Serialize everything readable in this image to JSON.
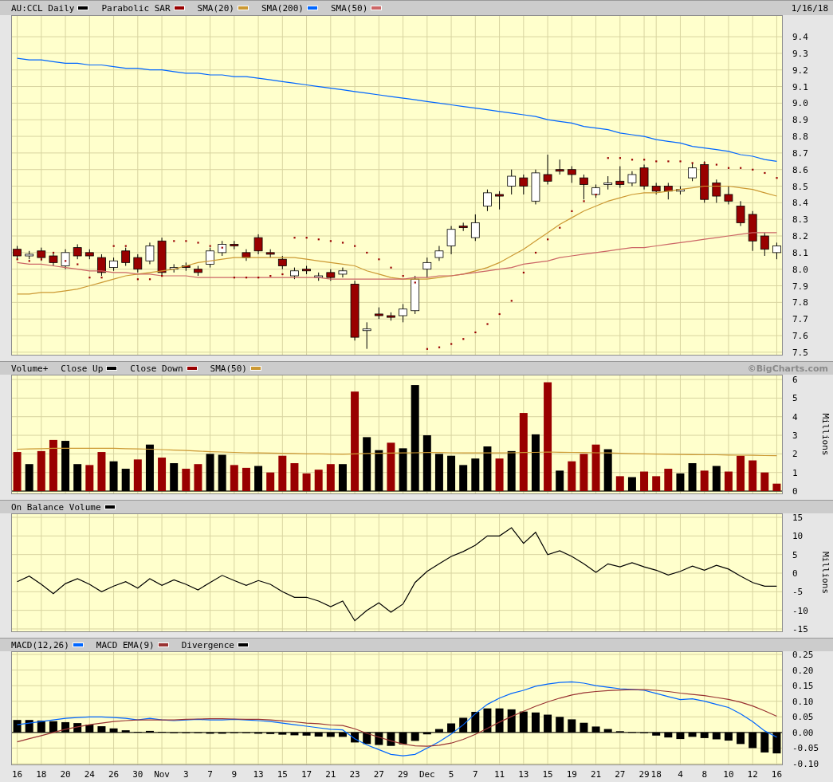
{
  "panels": [
    {
      "aside": {
        "kind": "date",
        "text": "1/16/18"
      },
      "chart_data": {
        "type": "candlestick",
        "title": "AU:CCL Daily",
        "grid": true,
        "ylim": [
          7.48,
          9.53
        ],
        "yticks": [
          {
            "value": 7.5,
            "label": "7.5"
          },
          {
            "value": 7.6,
            "label": "7.6"
          },
          {
            "value": 7.7,
            "label": "7.7"
          },
          {
            "value": 7.8,
            "label": "7.8"
          },
          {
            "value": 7.9,
            "label": "7.9"
          },
          {
            "value": 8.0,
            "label": "8.0"
          },
          {
            "value": 8.1,
            "label": "8.1"
          },
          {
            "value": 8.2,
            "label": "8.2"
          },
          {
            "value": 8.3,
            "label": "8.3"
          },
          {
            "value": 8.4,
            "label": "8.4"
          },
          {
            "value": 8.5,
            "label": "8.5"
          },
          {
            "value": 8.6,
            "label": "8.6"
          },
          {
            "value": 8.7,
            "label": "8.7"
          },
          {
            "value": 8.8,
            "label": "8.8"
          },
          {
            "value": 8.9,
            "label": "8.9"
          },
          {
            "value": 9.0,
            "label": "9.0"
          },
          {
            "value": 9.1,
            "label": "9.1"
          },
          {
            "value": 9.2,
            "label": "9.2"
          },
          {
            "value": 9.3,
            "label": "9.3"
          },
          {
            "value": 9.4,
            "label": "9.4"
          }
        ],
        "ohlc": [
          [
            8.12,
            8.14,
            8.06,
            8.08
          ],
          [
            8.08,
            8.11,
            8.06,
            8.09
          ],
          [
            8.11,
            8.13,
            8.05,
            8.07
          ],
          [
            8.08,
            8.1,
            8.02,
            8.04
          ],
          [
            8.02,
            8.12,
            8.0,
            8.1
          ],
          [
            8.13,
            8.15,
            8.06,
            8.08
          ],
          [
            8.1,
            8.12,
            8.06,
            8.08
          ],
          [
            8.07,
            8.09,
            7.96,
            7.98
          ],
          [
            8.01,
            8.07,
            7.99,
            8.05
          ],
          [
            8.11,
            8.13,
            8.02,
            8.04
          ],
          [
            8.07,
            8.09,
            7.98,
            8.0
          ],
          [
            8.05,
            8.16,
            8.03,
            8.14
          ],
          [
            8.17,
            8.19,
            7.96,
            7.98
          ],
          [
            8.0,
            8.03,
            7.98,
            8.01
          ],
          [
            8.02,
            8.04,
            7.99,
            8.01
          ],
          [
            8.0,
            8.02,
            7.96,
            7.98
          ],
          [
            8.03,
            8.13,
            8.01,
            8.11
          ],
          [
            8.1,
            8.17,
            8.08,
            8.15
          ],
          [
            8.15,
            8.17,
            8.12,
            8.14
          ],
          [
            8.1,
            8.12,
            8.05,
            8.07
          ],
          [
            8.19,
            8.21,
            8.09,
            8.11
          ],
          [
            8.1,
            8.12,
            8.07,
            8.09
          ],
          [
            8.06,
            8.08,
            8.0,
            8.02
          ],
          [
            7.96,
            8.01,
            7.94,
            7.99
          ],
          [
            8.0,
            8.02,
            7.97,
            7.99
          ],
          [
            7.95,
            7.98,
            7.93,
            7.96
          ],
          [
            7.98,
            8.0,
            7.93,
            7.95
          ],
          [
            7.97,
            8.01,
            7.95,
            7.99
          ],
          [
            7.91,
            7.93,
            7.57,
            7.59
          ],
          [
            7.63,
            7.68,
            7.52,
            7.64
          ],
          [
            7.73,
            7.77,
            7.7,
            7.72
          ],
          [
            7.72,
            7.74,
            7.69,
            7.71
          ],
          [
            7.72,
            7.79,
            7.68,
            7.76
          ],
          [
            7.75,
            7.96,
            7.73,
            7.94
          ],
          [
            8.0,
            8.07,
            7.95,
            8.04
          ],
          [
            8.07,
            8.14,
            8.05,
            8.11
          ],
          [
            8.14,
            8.26,
            8.09,
            8.24
          ],
          [
            8.26,
            8.28,
            8.23,
            8.25
          ],
          [
            8.19,
            8.33,
            8.17,
            8.28
          ],
          [
            8.38,
            8.48,
            8.35,
            8.46
          ],
          [
            8.45,
            8.47,
            8.36,
            8.44
          ],
          [
            8.5,
            8.6,
            8.45,
            8.56
          ],
          [
            8.55,
            8.57,
            8.45,
            8.5
          ],
          [
            8.41,
            8.6,
            8.39,
            8.58
          ],
          [
            8.57,
            8.69,
            8.51,
            8.53
          ],
          [
            8.6,
            8.66,
            8.57,
            8.59
          ],
          [
            8.6,
            8.62,
            8.52,
            8.57
          ],
          [
            8.55,
            8.57,
            8.42,
            8.51
          ],
          [
            8.45,
            8.51,
            8.43,
            8.49
          ],
          [
            8.51,
            8.56,
            8.48,
            8.52
          ],
          [
            8.53,
            8.62,
            8.49,
            8.51
          ],
          [
            8.52,
            8.59,
            8.5,
            8.57
          ],
          [
            8.61,
            8.63,
            8.48,
            8.5
          ],
          [
            8.5,
            8.52,
            8.45,
            8.47
          ],
          [
            8.5,
            8.52,
            8.42,
            8.47
          ],
          [
            8.47,
            8.5,
            8.45,
            8.48
          ],
          [
            8.55,
            8.64,
            8.53,
            8.61
          ],
          [
            8.63,
            8.65,
            8.4,
            8.42
          ],
          [
            8.52,
            8.54,
            8.4,
            8.44
          ],
          [
            8.45,
            8.5,
            8.39,
            8.41
          ],
          [
            8.38,
            8.41,
            8.26,
            8.28
          ],
          [
            8.33,
            8.35,
            8.11,
            8.17
          ],
          [
            8.2,
            8.22,
            8.08,
            8.12
          ],
          [
            8.1,
            8.16,
            8.06,
            8.14
          ]
        ],
        "series": [
          {
            "name": "Parabolic SAR",
            "type": "scatter",
            "marker": "square",
            "color": "#990000",
            "values": [
              8.06,
              8.05,
              8.06,
              8.1,
              8.05,
              8.03,
              7.95,
              7.95,
              8.14,
              8.14,
              7.94,
              7.94,
              7.96,
              8.17,
              8.17,
              8.16,
              8.14,
              8.13,
              7.95,
              7.95,
              7.95,
              7.96,
              7.97,
              8.19,
              8.19,
              8.18,
              8.17,
              8.16,
              8.14,
              8.1,
              8.06,
              8.01,
              7.96,
              7.92,
              7.52,
              7.53,
              7.55,
              7.58,
              7.62,
              7.67,
              7.73,
              7.81,
              7.98,
              8.1,
              8.18,
              8.25,
              8.35,
              8.41,
              8.45,
              8.67,
              8.67,
              8.66,
              8.66,
              8.65,
              8.65,
              8.65,
              8.64,
              8.64,
              8.63,
              8.61,
              8.61,
              8.6,
              8.58,
              8.55
            ]
          },
          {
            "name": "SMA(20)",
            "type": "line",
            "color": "#cc9933",
            "values": [
              7.85,
              7.85,
              7.86,
              7.86,
              7.87,
              7.88,
              7.9,
              7.92,
              7.94,
              7.96,
              7.97,
              7.98,
              7.99,
              8.0,
              8.02,
              8.04,
              8.05,
              8.06,
              8.07,
              8.07,
              8.07,
              8.07,
              8.07,
              8.07,
              8.06,
              8.05,
              8.04,
              8.03,
              8.02,
              7.99,
              7.97,
              7.95,
              7.94,
              7.94,
              7.94,
              7.95,
              7.96,
              7.97,
              7.99,
              8.01,
              8.04,
              8.08,
              8.12,
              8.17,
              8.22,
              8.27,
              8.31,
              8.35,
              8.38,
              8.41,
              8.43,
              8.45,
              8.46,
              8.46,
              8.47,
              8.48,
              8.49,
              8.5,
              8.5,
              8.5,
              8.49,
              8.48,
              8.46,
              8.44
            ]
          },
          {
            "name": "SMA(200)",
            "type": "line",
            "color": "#0066ff",
            "values": [
              9.27,
              9.26,
              9.26,
              9.25,
              9.24,
              9.24,
              9.23,
              9.23,
              9.22,
              9.21,
              9.21,
              9.2,
              9.2,
              9.19,
              9.18,
              9.18,
              9.17,
              9.17,
              9.16,
              9.16,
              9.15,
              9.14,
              9.13,
              9.12,
              9.11,
              9.1,
              9.09,
              9.08,
              9.07,
              9.06,
              9.05,
              9.04,
              9.03,
              9.02,
              9.01,
              9.0,
              8.99,
              8.98,
              8.97,
              8.96,
              8.95,
              8.94,
              8.93,
              8.92,
              8.9,
              8.89,
              8.88,
              8.86,
              8.85,
              8.84,
              8.82,
              8.81,
              8.8,
              8.78,
              8.77,
              8.76,
              8.74,
              8.73,
              8.72,
              8.71,
              8.69,
              8.68,
              8.66,
              8.65
            ]
          },
          {
            "name": "SMA(50)",
            "type": "line",
            "color": "#cc6666",
            "values": [
              8.04,
              8.03,
              8.03,
              8.02,
              8.01,
              8.0,
              7.99,
              7.99,
              7.98,
              7.98,
              7.97,
              7.97,
              7.96,
              7.96,
              7.96,
              7.95,
              7.95,
              7.95,
              7.95,
              7.95,
              7.95,
              7.95,
              7.95,
              7.95,
              7.95,
              7.95,
              7.94,
              7.94,
              7.94,
              7.94,
              7.94,
              7.94,
              7.94,
              7.95,
              7.95,
              7.96,
              7.96,
              7.97,
              7.98,
              7.99,
              8.0,
              8.01,
              8.03,
              8.04,
              8.05,
              8.07,
              8.08,
              8.09,
              8.1,
              8.11,
              8.12,
              8.13,
              8.13,
              8.14,
              8.15,
              8.16,
              8.17,
              8.18,
              8.19,
              8.2,
              8.21,
              8.22,
              8.22,
              8.22
            ]
          }
        ]
      }
    },
    {
      "aside": {
        "kind": "credit",
        "text": "©BigCharts.com"
      },
      "chart_data": {
        "type": "bar",
        "title": "Volume+",
        "ylabel": "Millions",
        "grid": true,
        "ylim": [
          -0.17,
          6.26
        ],
        "yticks": [
          {
            "value": 0,
            "label": "0"
          },
          {
            "value": 1,
            "label": "1"
          },
          {
            "value": 2,
            "label": "2"
          },
          {
            "value": 3,
            "label": "3"
          },
          {
            "value": 4,
            "label": "4"
          },
          {
            "value": 5,
            "label": "5"
          },
          {
            "value": 6,
            "label": "6"
          }
        ],
        "series": [
          {
            "name": "Close Up",
            "type": "bar",
            "color": "#000000",
            "values": [
              null,
              1.45,
              null,
              null,
              2.7,
              1.45,
              null,
              null,
              1.6,
              1.2,
              null,
              2.5,
              null,
              1.5,
              null,
              null,
              2.0,
              1.95,
              null,
              null,
              1.35,
              null,
              null,
              null,
              null,
              null,
              null,
              1.45,
              null,
              2.9,
              2.2,
              null,
              2.3,
              5.7,
              3.0,
              2.0,
              1.9,
              1.4,
              1.75,
              2.4,
              null,
              2.15,
              null,
              3.05,
              null,
              1.1,
              null,
              null,
              null,
              2.25,
              null,
              0.75,
              null,
              null,
              null,
              0.95,
              1.5,
              null,
              1.35,
              null,
              null,
              null,
              null,
              null
            ]
          },
          {
            "name": "Close Down",
            "type": "bar",
            "color": "#990000",
            "values": [
              2.1,
              null,
              2.15,
              2.75,
              null,
              null,
              1.4,
              2.1,
              null,
              null,
              1.7,
              null,
              1.8,
              null,
              1.2,
              1.45,
              null,
              null,
              1.4,
              1.25,
              null,
              1.0,
              1.9,
              1.5,
              0.95,
              1.15,
              1.45,
              null,
              5.35,
              null,
              null,
              2.6,
              null,
              null,
              null,
              null,
              null,
              null,
              null,
              null,
              1.75,
              null,
              4.2,
              null,
              5.85,
              null,
              1.6,
              2.0,
              2.5,
              null,
              0.8,
              null,
              1.05,
              0.8,
              1.2,
              null,
              null,
              1.1,
              null,
              1.05,
              1.9,
              1.65,
              1.0,
              0.4
            ]
          },
          {
            "name": "SMA(50)",
            "type": "line",
            "color": "#cc9933",
            "values": [
              2.25,
              2.27,
              2.28,
              2.3,
              2.3,
              2.3,
              2.3,
              2.3,
              2.3,
              2.28,
              2.27,
              2.25,
              2.23,
              2.2,
              2.18,
              2.15,
              2.12,
              2.1,
              2.08,
              2.06,
              2.05,
              2.04,
              2.03,
              2.02,
              2.0,
              2.0,
              1.99,
              1.98,
              2.0,
              2.02,
              2.03,
              2.04,
              2.05,
              2.06,
              2.07,
              2.07,
              2.06,
              2.05,
              2.05,
              2.05,
              2.05,
              2.06,
              2.07,
              2.08,
              2.1,
              2.09,
              2.08,
              2.07,
              2.06,
              2.05,
              2.03,
              2.01,
              2.0,
              1.99,
              1.98,
              1.97,
              1.96,
              1.95,
              1.95,
              1.94,
              1.93,
              1.92,
              1.91,
              1.9
            ]
          }
        ]
      }
    },
    {
      "chart_data": {
        "type": "line",
        "ylabel": "Millions",
        "grid": true,
        "ylim": [
          -15.86,
          16.07
        ],
        "yticks": [
          {
            "value": -15,
            "label": "-15"
          },
          {
            "value": -10,
            "label": "-10"
          },
          {
            "value": -5,
            "label": "-5"
          },
          {
            "value": 0,
            "label": "0"
          },
          {
            "value": 5,
            "label": "5"
          },
          {
            "value": 10,
            "label": "10"
          },
          {
            "value": 15,
            "label": "15"
          }
        ],
        "series": [
          {
            "name": "On Balance Volume",
            "type": "line",
            "color": "#000000",
            "values": [
              -2.3,
              -0.8,
              -3,
              -5.5,
              -2.8,
              -1.5,
              -3,
              -5,
              -3.5,
              -2.3,
              -4,
              -1.5,
              -3.3,
              -1.8,
              -3,
              -4.5,
              -2.5,
              -0.6,
              -2,
              -3.3,
              -2,
              -3,
              -5,
              -6.5,
              -6.5,
              -7.5,
              -9,
              -7.5,
              -12.8,
              -10,
              -8,
              -10.5,
              -8.3,
              -2.5,
              0.5,
              2.5,
              4.5,
              5.8,
              7.5,
              10,
              10,
              12.2,
              8,
              11,
              5,
              6,
              4.5,
              2.5,
              0.2,
              2.5,
              1.7,
              2.8,
              1.7,
              0.8,
              -0.5,
              0.5,
              1.9,
              0.8,
              2.1,
              1.1,
              -0.8,
              -2.5,
              -3.5,
              -3.5
            ]
          }
        ]
      }
    },
    {
      "chart_data": {
        "type": "line",
        "grid": true,
        "ylim": [
          -0.105,
          0.26
        ],
        "categories": [
          "16",
          null,
          "18",
          null,
          "20",
          null,
          "24",
          null,
          "26",
          null,
          "30",
          null,
          "Nov",
          null,
          "3",
          null,
          "7",
          null,
          "9",
          null,
          "13",
          null,
          "15",
          null,
          "17",
          null,
          "21",
          null,
          "23",
          null,
          "27",
          null,
          "29",
          null,
          "Dec",
          null,
          "5",
          null,
          "7",
          null,
          "11",
          null,
          "13",
          null,
          "15",
          null,
          "19",
          null,
          "21",
          null,
          "27",
          null,
          "29",
          "18",
          null,
          "4",
          null,
          "8",
          null,
          "10",
          null,
          "12",
          null,
          "16"
        ],
        "yticks": [
          {
            "value": -0.1,
            "label": "-0.10"
          },
          {
            "value": -0.05,
            "label": "-0.05"
          },
          {
            "value": 0,
            "label": "0.00"
          },
          {
            "value": 0.05,
            "label": "0.05"
          },
          {
            "value": 0.1,
            "label": "0.10"
          },
          {
            "value": 0.15,
            "label": "0.15"
          },
          {
            "value": 0.2,
            "label": "0.20"
          },
          {
            "value": 0.25,
            "label": "0.25"
          }
        ],
        "series": [
          {
            "name": "MACD(12,26)",
            "type": "line",
            "color": "#0066ff",
            "values": [
              0.025,
              0.03,
              0.035,
              0.04,
              0.045,
              0.048,
              0.05,
              0.05,
              0.048,
              0.045,
              0.04,
              0.045,
              0.04,
              0.038,
              0.04,
              0.042,
              0.04,
              0.04,
              0.042,
              0.04,
              0.038,
              0.035,
              0.03,
              0.025,
              0.02,
              0.015,
              0.01,
              0.008,
              -0.02,
              -0.04,
              -0.055,
              -0.07,
              -0.075,
              -0.07,
              -0.05,
              -0.03,
              -0.005,
              0.025,
              0.06,
              0.09,
              0.11,
              0.125,
              0.135,
              0.148,
              0.155,
              0.16,
              0.162,
              0.158,
              0.15,
              0.145,
              0.14,
              0.138,
              0.135,
              0.125,
              0.115,
              0.105,
              0.108,
              0.1,
              0.09,
              0.08,
              0.06,
              0.035,
              0.005,
              -0.015
            ]
          },
          {
            "name": "MACD EMA(9)",
            "type": "line",
            "color": "#993333",
            "values": [
              -0.03,
              -0.02,
              -0.01,
              0.0,
              0.01,
              0.018,
              0.025,
              0.03,
              0.035,
              0.038,
              0.04,
              0.04,
              0.04,
              0.04,
              0.042,
              0.043,
              0.044,
              0.044,
              0.043,
              0.042,
              0.042,
              0.04,
              0.037,
              0.034,
              0.03,
              0.028,
              0.024,
              0.022,
              0.012,
              -0.003,
              -0.015,
              -0.027,
              -0.037,
              -0.043,
              -0.044,
              -0.041,
              -0.034,
              -0.022,
              -0.006,
              0.013,
              0.033,
              0.051,
              0.068,
              0.084,
              0.098,
              0.11,
              0.12,
              0.127,
              0.131,
              0.134,
              0.136,
              0.137,
              0.137,
              0.135,
              0.131,
              0.126,
              0.122,
              0.118,
              0.112,
              0.106,
              0.097,
              0.085,
              0.069,
              0.052
            ]
          },
          {
            "name": "Divergence",
            "type": "bar",
            "color": "#000000",
            "values": [
              0.04,
              0.04,
              0.038,
              0.036,
              0.033,
              0.03,
              0.025,
              0.02,
              0.013,
              0.007,
              0.002,
              0.005,
              0.002,
              -0.002,
              -0.002,
              -0.001,
              -0.004,
              -0.004,
              -0.001,
              -0.002,
              -0.004,
              -0.005,
              -0.007,
              -0.009,
              -0.01,
              -0.013,
              -0.014,
              -0.014,
              -0.032,
              -0.037,
              -0.04,
              -0.043,
              -0.038,
              -0.027,
              -0.006,
              0.011,
              0.029,
              0.047,
              0.066,
              0.077,
              0.077,
              0.074,
              0.067,
              0.064,
              0.057,
              0.05,
              0.042,
              0.031,
              0.019,
              0.011,
              0.004,
              0.001,
              -0.002,
              -0.01,
              -0.016,
              -0.021,
              -0.014,
              -0.018,
              -0.022,
              -0.026,
              -0.037,
              -0.05,
              -0.064,
              -0.067
            ]
          }
        ]
      }
    }
  ]
}
